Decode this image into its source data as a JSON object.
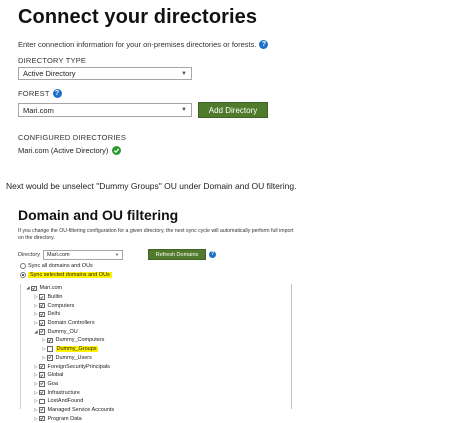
{
  "connect": {
    "title": "Connect your directories",
    "intro": "Enter connection information for your on-premises directories or forests.",
    "directory_type_label": "DIRECTORY TYPE",
    "directory_type_value": "Active Directory",
    "forest_label": "FOREST",
    "forest_value": "Mari.com",
    "add_directory_label": "Add Directory",
    "configured_label": "CONFIGURED DIRECTORIES",
    "configured_item": "Mari.com (Active Directory)"
  },
  "note": "Next would be unselect \"Dummy Groups\" OU under Domain and OU filtering.",
  "filter": {
    "title": "Domain and OU filtering",
    "intro": "If you change the OU-filtering configuration for a given directory, the next sync cycle will automatically perform full import on the directory.",
    "directory_label": "Directory",
    "directory_value": "Mari.com",
    "refresh_label": "Refresh Domains",
    "radio_all": "Sync all domains and OUs",
    "radio_selected": "Sync selected domains and OUs",
    "tree": [
      {
        "label": "Mari.com",
        "level": 0,
        "checked": true,
        "expanded": true
      },
      {
        "label": "Builtin",
        "level": 1,
        "checked": true
      },
      {
        "label": "Computers",
        "level": 1,
        "checked": true
      },
      {
        "label": "Delhi",
        "level": 1,
        "checked": true
      },
      {
        "label": "Domain Controllers",
        "level": 1,
        "checked": true
      },
      {
        "label": "Dummy_OU",
        "level": 1,
        "checked": true,
        "expanded": true
      },
      {
        "label": "Dummy_Computers",
        "level": 2,
        "checked": true
      },
      {
        "label": "Dummy_Groups",
        "level": 2,
        "checked": false,
        "highlight": true
      },
      {
        "label": "Dummy_Users",
        "level": 2,
        "checked": true
      },
      {
        "label": "ForeignSecurityPrincipals",
        "level": 1,
        "checked": true
      },
      {
        "label": "Global",
        "level": 1,
        "checked": true
      },
      {
        "label": "Goa",
        "level": 1,
        "checked": true
      },
      {
        "label": "Infrastructure",
        "level": 1,
        "checked": true
      },
      {
        "label": "LostAndFound",
        "level": 1,
        "checked": false
      },
      {
        "label": "Managed Service Accounts",
        "level": 1,
        "checked": true
      },
      {
        "label": "Program Data",
        "level": 1,
        "checked": true
      }
    ]
  },
  "colors": {
    "accent_green": "#507b2c",
    "help_blue": "#1e6fc6",
    "ok_green": "#2e9a2e",
    "highlight": "#fff200"
  }
}
